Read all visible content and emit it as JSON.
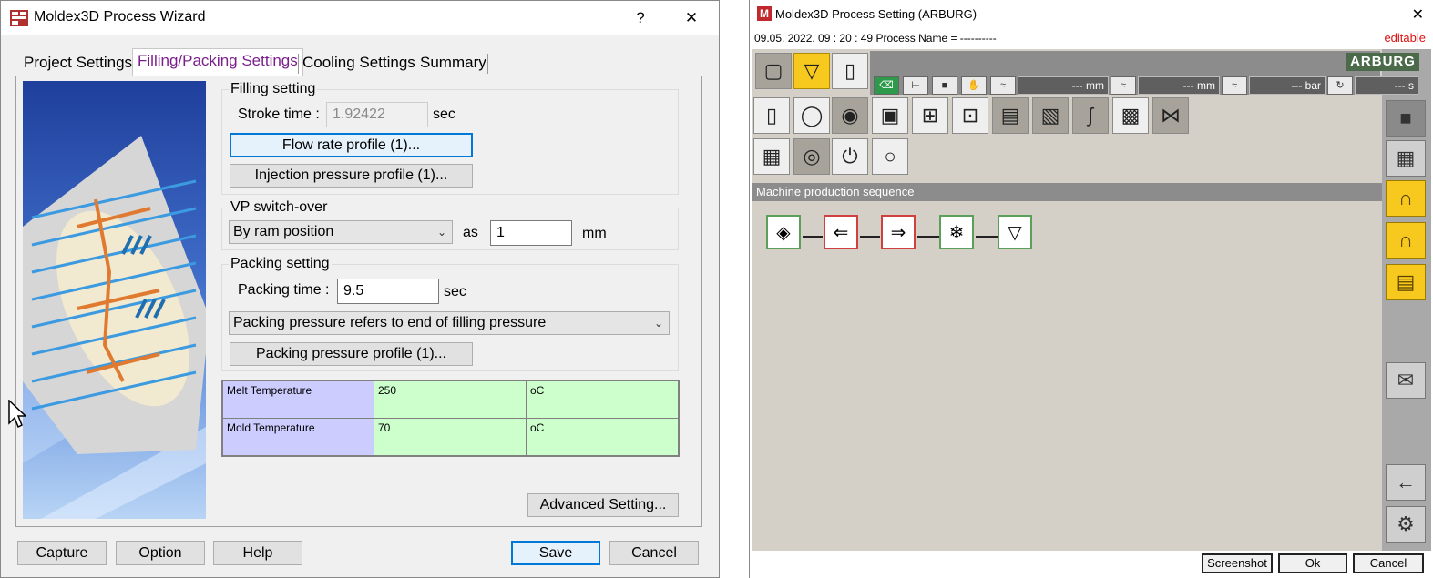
{
  "wizard": {
    "title": "Moldex3D Process Wizard",
    "help": "?",
    "close": "✕",
    "tabs": [
      {
        "label": "Project Settings"
      },
      {
        "label": "Filling/Packing Settings"
      },
      {
        "label": "Cooling Settings"
      },
      {
        "label": "Summary"
      }
    ],
    "filling": {
      "group_label": "Filling setting",
      "stroke_label": "Stroke time :",
      "stroke_value": "1.92422",
      "stroke_unit": "sec",
      "flow_rate_button": "Flow rate profile (1)...",
      "injection_pressure_button": "Injection pressure profile (1)..."
    },
    "vp": {
      "group_label": "VP switch-over",
      "mode": "By ram position",
      "as_label": "as",
      "value": "1",
      "unit": "mm"
    },
    "packing": {
      "group_label": "Packing setting",
      "time_label": "Packing time :",
      "time_value": "9.5",
      "time_unit": "sec",
      "pressure_mode": "Packing pressure refers to end of filling pressure",
      "pressure_button": "Packing pressure profile (1)..."
    },
    "temps": [
      {
        "name": "Melt Temperature",
        "value": "250",
        "unit": "oC"
      },
      {
        "name": "Mold Temperature",
        "value": "70",
        "unit": "oC"
      }
    ],
    "advanced_button": "Advanced Setting...",
    "footer": {
      "capture": "Capture",
      "option": "Option",
      "help": "Help",
      "save": "Save",
      "cancel": "Cancel"
    }
  },
  "arburg": {
    "title": "Moldex3D Process Setting (ARBURG)",
    "close": "✕",
    "info": "09.05. 2022. 09 : 20 : 49 Process Name = ----------",
    "status": "editable",
    "brand": "ARBURG",
    "readouts": [
      "--- mm",
      "--- mm",
      "--- bar",
      "--- s"
    ],
    "section_title": "Machine production sequence",
    "buttons": {
      "screenshot": "Screenshot",
      "ok": "Ok",
      "cancel": "Cancel"
    },
    "colors": {
      "accent_yellow": "#f7c81d",
      "panel_grey": "#d4d0c8",
      "edit_red": "#e01010"
    }
  }
}
